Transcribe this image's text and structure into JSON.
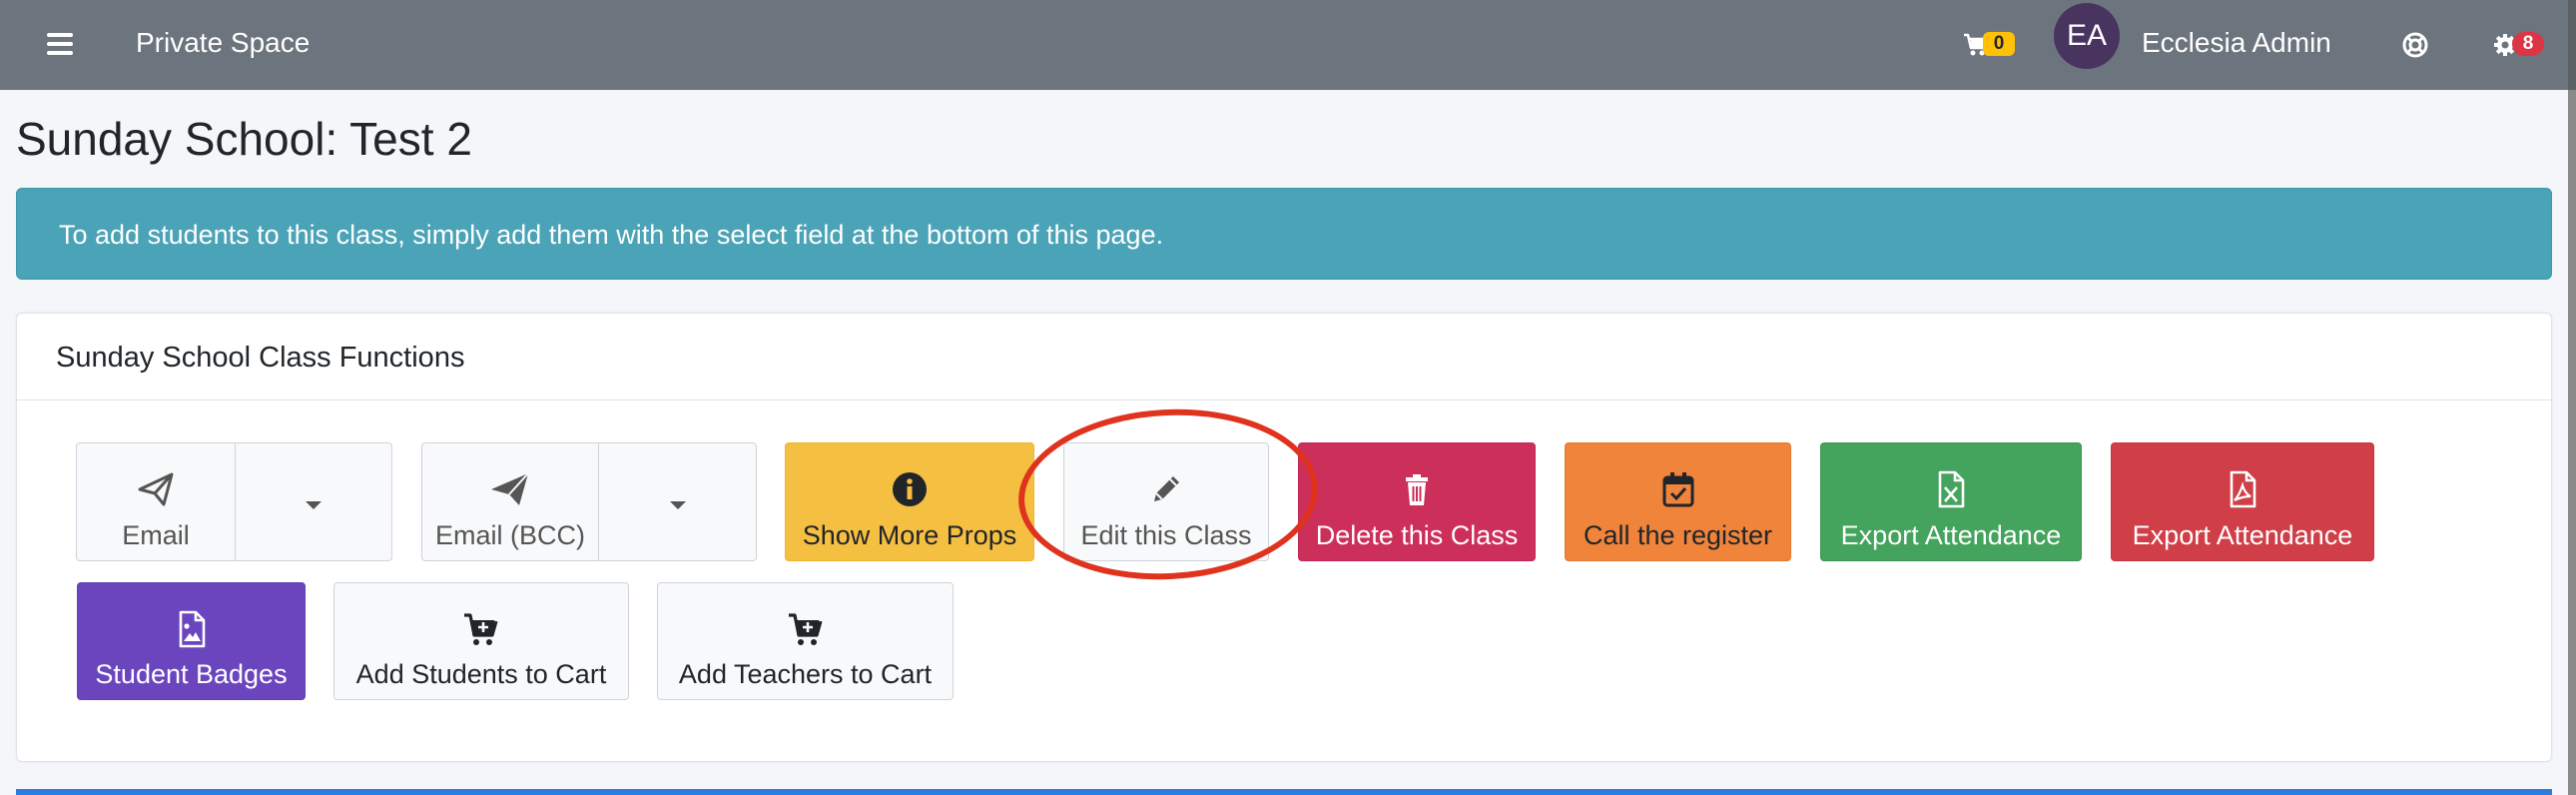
{
  "navbar": {
    "brand": "Private Space",
    "cart_count": "0",
    "avatar_initials": "EA",
    "username": "Ecclesia Admin",
    "notification_count": "8"
  },
  "page": {
    "title": "Sunday School: Test 2"
  },
  "alert": {
    "text": "To add students to this class, simply add them with the select field at the bottom of this page."
  },
  "functions_card": {
    "title": "Sunday School Class Functions",
    "buttons": {
      "email": "Email",
      "email_bcc": "Email (BCC)",
      "show_more_props": "Show More Props",
      "edit_class": "Edit this Class",
      "delete_class": "Delete this Class",
      "call_register": "Call the register",
      "export_attendance_excel": "Export Attendance",
      "export_attendance_pdf": "Export Attendance",
      "student_badges": "Student Badges",
      "add_students_to_cart": "Add Students to Cart",
      "add_teachers_to_cart": "Add Teachers to Cart"
    }
  },
  "icons": {
    "menu": "hamburger-icon",
    "cart": "cart-icon",
    "help": "lifebuoy-icon",
    "settings": "gear-icon",
    "email": "paper-plane-outline-icon",
    "email_bcc": "paper-plane-icon",
    "info": "info-circle-icon",
    "edit": "pencil-icon",
    "delete": "trash-icon",
    "register": "calendar-check-icon",
    "excel": "file-excel-icon",
    "pdf": "file-pdf-icon",
    "badge": "file-image-icon",
    "cart_plus": "cart-plus-icon"
  },
  "colors": {
    "navbar": "#6c757d",
    "alert_info": "#4aa3b6",
    "warning": "#f5bf42",
    "pink": "#cd2f5b",
    "orange": "#f0843a",
    "success": "#44a35c",
    "danger": "#d03e48",
    "purple": "#6b45be",
    "annotation_circle": "#e0331e"
  }
}
